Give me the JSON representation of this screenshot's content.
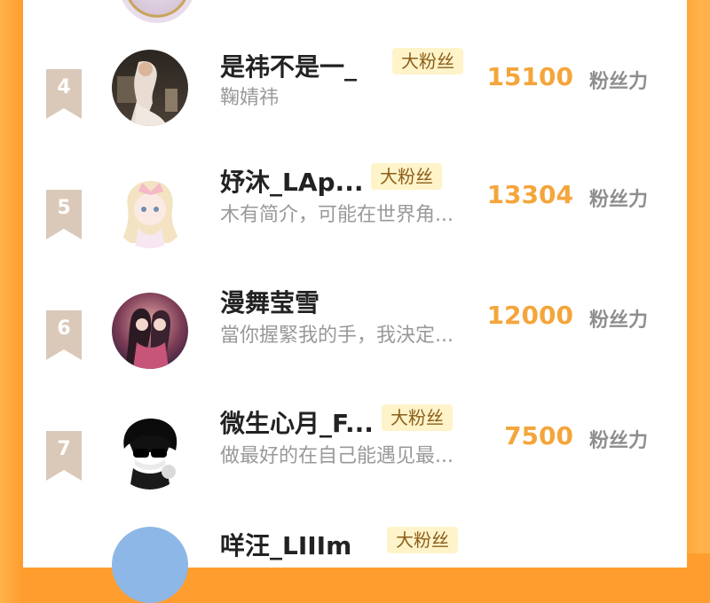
{
  "colors": {
    "background": "#FF9D2E",
    "card": "#FFFFFF",
    "rank_badge": "#DAC9B8",
    "name": "#222222",
    "badge_bg": "#FFF3C9",
    "badge_text": "#8B5E1A",
    "score": "#F4A53B",
    "unit": "#8E8E8E",
    "desc": "#999999"
  },
  "unit_label": "粉丝力",
  "rows": [
    {
      "rank": "4",
      "name": "是祎不是一_",
      "badge": "大粉丝",
      "desc": "鞠婧祎",
      "score": "15100",
      "avatar": "avatar-photo-icon"
    },
    {
      "rank": "5",
      "name": "妤沐_LAp...",
      "badge": "大粉丝",
      "desc": "木有简介，可能在世界角...",
      "score": "13304",
      "avatar": "anime-girl-avatar-icon"
    },
    {
      "rank": "6",
      "name": "漫舞莹雪",
      "badge": "",
      "desc": "當你握緊我的手，我決定...",
      "score": "12000",
      "avatar": "couple-artwork-avatar-icon"
    },
    {
      "rank": "7",
      "name": "微生心月_F...",
      "badge": "大粉丝",
      "desc": "做最好的在自己能遇见最...",
      "score": "7500",
      "avatar": "sunglasses-character-avatar-icon"
    },
    {
      "rank": "",
      "name": "咩汪_LIIIm",
      "badge": "大粉丝",
      "desc": "",
      "score": "",
      "avatar": "partial-avatar-icon"
    }
  ]
}
